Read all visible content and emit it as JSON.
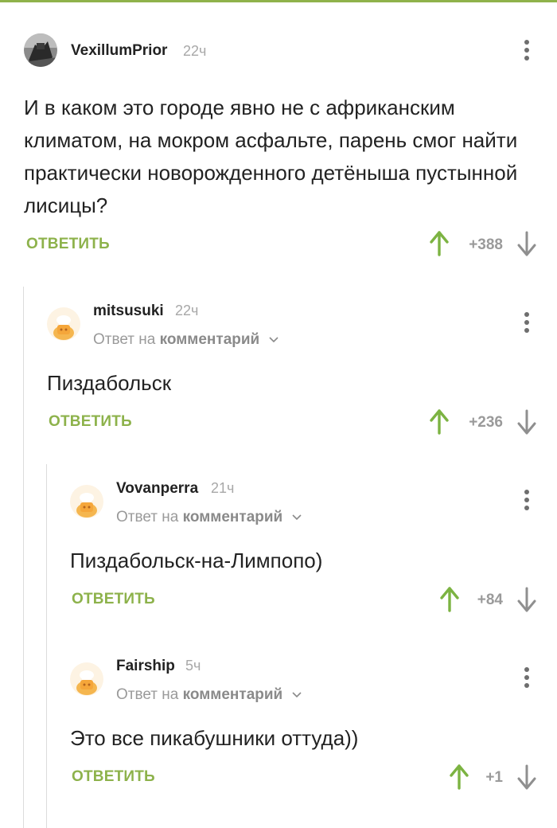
{
  "comments": [
    {
      "username": "VexillumPrior",
      "time": "22ч",
      "text": "И в каком это городе явно не с африканским климатом, на мокром асфальте, парень смог найти практически новорожденного детёныша пустынной лисицы?",
      "reply_label": "ОТВЕТИТЬ",
      "score": "+388"
    },
    {
      "username": "mitsusuki",
      "time": "22ч",
      "reply_prefix": "Ответ на",
      "reply_link": "комментарий",
      "text": "Пиздабольск",
      "reply_label": "ОТВЕТИТЬ",
      "score": "+236"
    },
    {
      "username": "Vovanperra",
      "time": "21ч",
      "reply_prefix": "Ответ на",
      "reply_link": "комментарий",
      "text": "Пиздабольск-на-Лимпопо)",
      "reply_label": "ОТВЕТИТЬ",
      "score": "+84"
    },
    {
      "username": "Fairship",
      "time": "5ч",
      "reply_prefix": "Ответ на",
      "reply_link": "комментарий",
      "text": "Это все пикабушники оттуда))",
      "reply_label": "ОТВЕТИТЬ",
      "score": "+1"
    }
  ],
  "colors": {
    "accent": "#8db24b",
    "upvote": "#7cb342",
    "muted": "#9a9a9a"
  },
  "icons": [
    "menu-dots-icon",
    "upvote-arrow-icon",
    "downvote-arrow-icon",
    "chevron-down-icon",
    "default-avatar-icon"
  ]
}
